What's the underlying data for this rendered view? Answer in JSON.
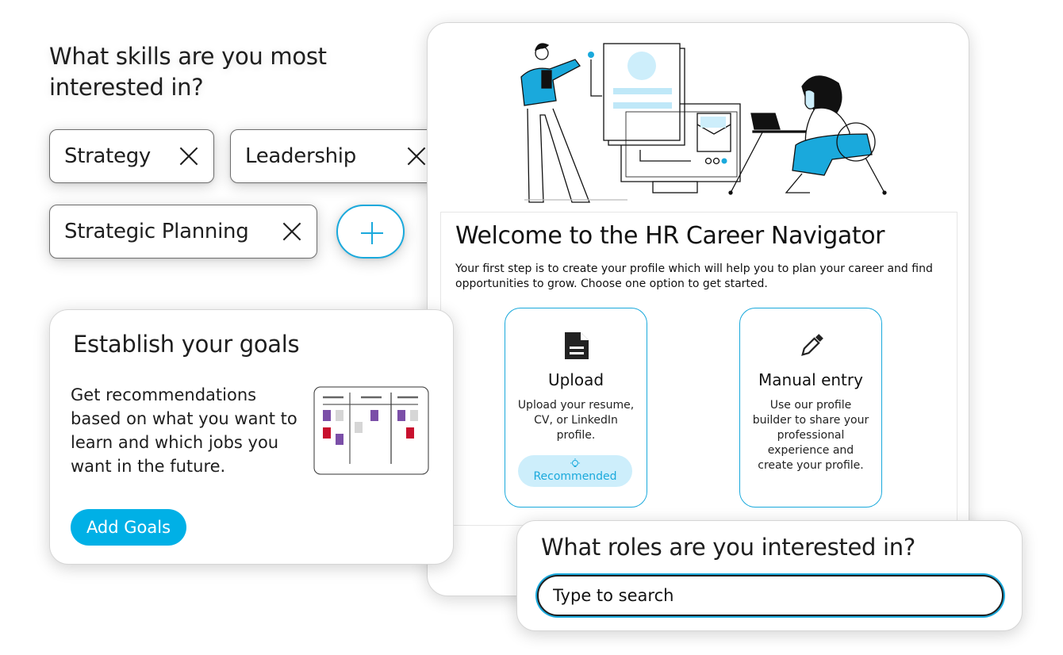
{
  "skills": {
    "title": "What skills are you most interested in?",
    "chips": [
      {
        "label": "Strategy",
        "remove_icon": "close-icon"
      },
      {
        "label": "Leadership",
        "remove_icon": "close-icon"
      },
      {
        "label": "Strategic Planning",
        "remove_icon": "close-icon"
      }
    ],
    "add_icon": "plus-icon"
  },
  "welcome": {
    "title": "Welcome to the HR Career Navigator",
    "description": "Your first step is to create your profile which will help you to plan your career and find opportunities to grow. Choose one option to get started.",
    "options": [
      {
        "icon": "document-icon",
        "title": "Upload",
        "description": "Upload your resume, CV, or LinkedIn profile.",
        "badge": {
          "icon": "lightbulb-icon",
          "label": "Recommended"
        }
      },
      {
        "icon": "pencil-icon",
        "title": "Manual entry",
        "description": "Use our profile builder to share your professional experience and create your profile."
      }
    ]
  },
  "goals": {
    "title": "Establish your goals",
    "description": "Get recommendations based on what you want to learn and which jobs you want in the future.",
    "button_label": "Add Goals",
    "illustration": "kanban-board-icon"
  },
  "roles": {
    "title": "What roles are you interested in?",
    "search_placeholder": "Type to search"
  },
  "colors": {
    "accent": "#1aa9dc",
    "button": "#00b0e6",
    "badge_bg": "#cdeefb",
    "kanban_purple": "#7b4fa8",
    "kanban_red": "#c8102e",
    "kanban_gray": "#d6d6d6"
  }
}
